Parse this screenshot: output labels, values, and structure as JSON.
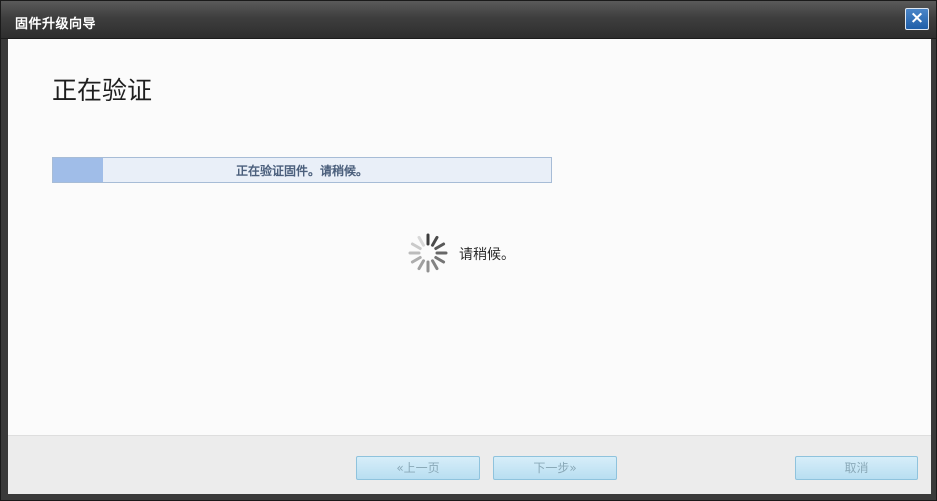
{
  "window": {
    "title": "固件升级向导",
    "close_label": "×"
  },
  "page": {
    "title": "正在验证"
  },
  "progress": {
    "label": "正在验证固件。请稍候。",
    "fraction": 0.1
  },
  "status": {
    "wait_label": "请稍候。"
  },
  "footer": {
    "back_label": "«上一页",
    "next_label": "下一步»",
    "cancel_label": "取消"
  },
  "icons": {
    "close": "close-icon",
    "spinner": "loading-spinner-icon"
  },
  "colors": {
    "progress_fill": "#a0bde8",
    "progress_track": "#e9eff8",
    "button": "#c6e6f5"
  }
}
